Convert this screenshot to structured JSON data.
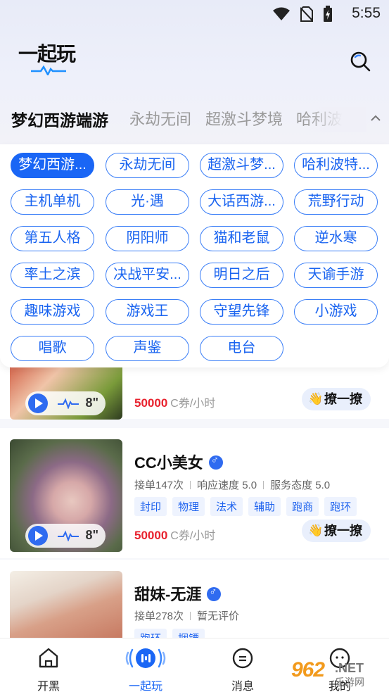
{
  "status_bar": {
    "time": "5:55"
  },
  "header": {
    "logo_text": "一起玩"
  },
  "categories": {
    "active": "梦幻西游端游",
    "others": [
      "永劫无间",
      "超激斗梦境",
      "哈利波特"
    ]
  },
  "chips": [
    "梦幻西游...",
    "永劫无间",
    "超激斗梦...",
    "哈利波特...",
    "主机单机",
    "光·遇",
    "大话西游...",
    "荒野行动",
    "第五人格",
    "阴阳师",
    "猫和老鼠",
    "逆水寒",
    "率土之滨",
    "决战平安...",
    "明日之后",
    "天谕手游",
    "趣味游戏",
    "游戏王",
    "守望先锋",
    "小游戏",
    "唱歌",
    "声鉴",
    "电台"
  ],
  "cards": [
    {
      "voice_duration": "8\"",
      "price_value": "50000",
      "price_unit": "C券/小时",
      "flirt_label": "撩一撩"
    },
    {
      "name": "CC小美女",
      "stats": {
        "orders": "接单147次",
        "speed": "响应速度 5.0",
        "attitude": "服务态度 5.0"
      },
      "tags": [
        "封印",
        "物理",
        "法术",
        "辅助",
        "跑商",
        "跑环"
      ],
      "voice_duration": "8\"",
      "price_value": "50000",
      "price_unit": "C券/小时",
      "flirt_label": "撩一撩"
    },
    {
      "name": "甜妹-无涯",
      "stats": {
        "orders": "接单278次",
        "rating": "暂无评价"
      },
      "tags": [
        "跑环",
        "捆镖"
      ]
    }
  ],
  "bottom_nav": [
    {
      "label": "开黑",
      "icon": "home-icon"
    },
    {
      "label": "一起玩",
      "icon": "play-together-icon"
    },
    {
      "label": "消息",
      "icon": "message-icon"
    },
    {
      "label": "我的",
      "icon": "profile-icon"
    }
  ],
  "watermark": {
    "num": "962",
    "net": ".NET",
    "cn": "乐游网"
  },
  "colors": {
    "accent": "#1a66f5",
    "price": "#e8222e",
    "tag_bg": "#eef3fe"
  }
}
